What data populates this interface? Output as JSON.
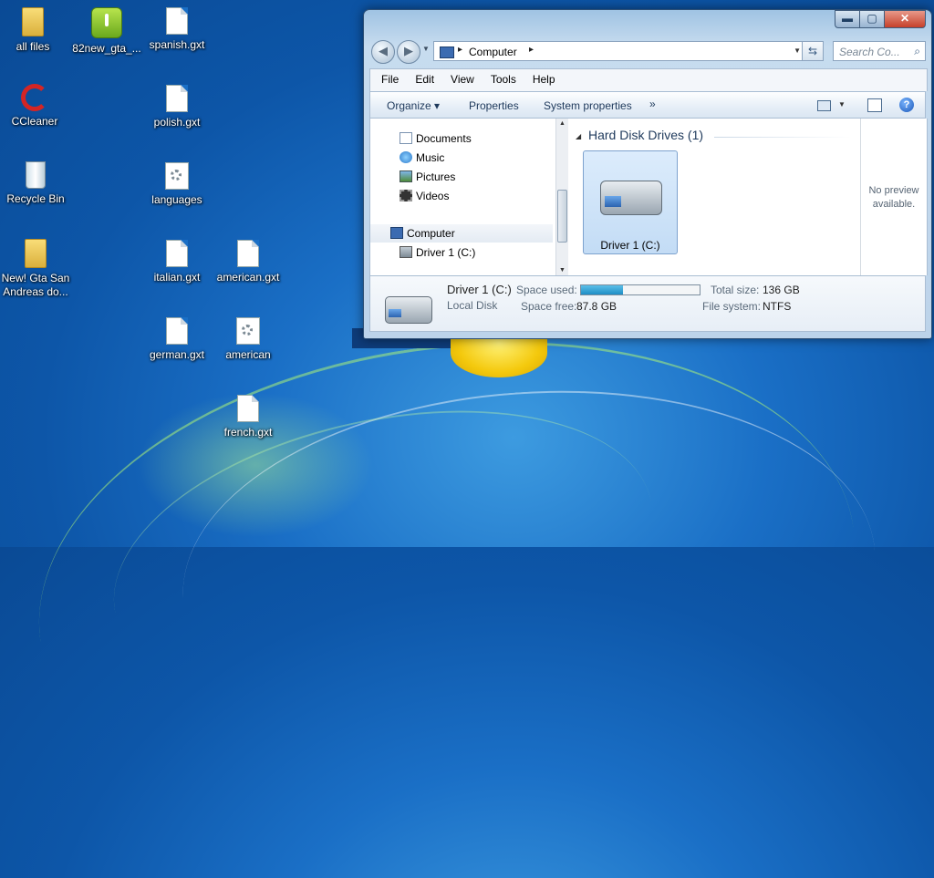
{
  "desktop": {
    "icons": [
      {
        "label": "all files",
        "icon": "folder-icon"
      },
      {
        "label": "82new_gta_...",
        "icon": "apk-icon"
      },
      {
        "label": "spanish.gxt",
        "icon": "document-icon"
      },
      {
        "label": "CCleaner",
        "icon": "ccleaner-icon"
      },
      {
        "label": "polish.gxt",
        "icon": "document-icon"
      },
      {
        "label": "Recycle Bin",
        "icon": "recycle-bin-icon"
      },
      {
        "label": "languages",
        "icon": "settings-file-icon"
      },
      {
        "label": "New! Gta San Andreas do...",
        "icon": "folder-icon"
      },
      {
        "label": "italian.gxt",
        "icon": "document-icon"
      },
      {
        "label": "american.gxt",
        "icon": "document-icon"
      },
      {
        "label": "german.gxt",
        "icon": "document-icon"
      },
      {
        "label": "american",
        "icon": "settings-file-icon"
      },
      {
        "label": "french.gxt",
        "icon": "document-icon"
      }
    ]
  },
  "window": {
    "caption": {
      "minimize": "▬",
      "maximize": "▢",
      "close": "✕"
    },
    "address": {
      "path_item": "Computer",
      "separator": "▸"
    },
    "search": {
      "placeholder": "Search Co..."
    },
    "menu": [
      "File",
      "Edit",
      "View",
      "Tools",
      "Help"
    ],
    "toolbar": {
      "organize": "Organize ▾",
      "properties": "Properties",
      "system_properties": "System properties",
      "more": "»"
    },
    "nav_pane": {
      "items": [
        "Documents",
        "Music",
        "Pictures",
        "Videos"
      ],
      "computer": "Computer",
      "drive": "Driver 1 (C:)"
    },
    "content": {
      "group_header": "Hard Disk Drives (1)",
      "drive_label": "Driver 1 (C:)"
    },
    "preview": {
      "text": "No preview available."
    },
    "details": {
      "name": "Driver 1 (C:)",
      "type": "Local Disk",
      "space_used_label": "Space used:",
      "space_free_label": "Space free:",
      "space_free_value": "87.8 GB",
      "total_size_label": "Total size:",
      "total_size_value": "136 GB",
      "file_system_label": "File system:",
      "file_system_value": "NTFS",
      "used_fraction": 0.354
    }
  },
  "colors": {
    "accent": "#1a6fc6",
    "usage_bar": "#1e8dc5"
  }
}
